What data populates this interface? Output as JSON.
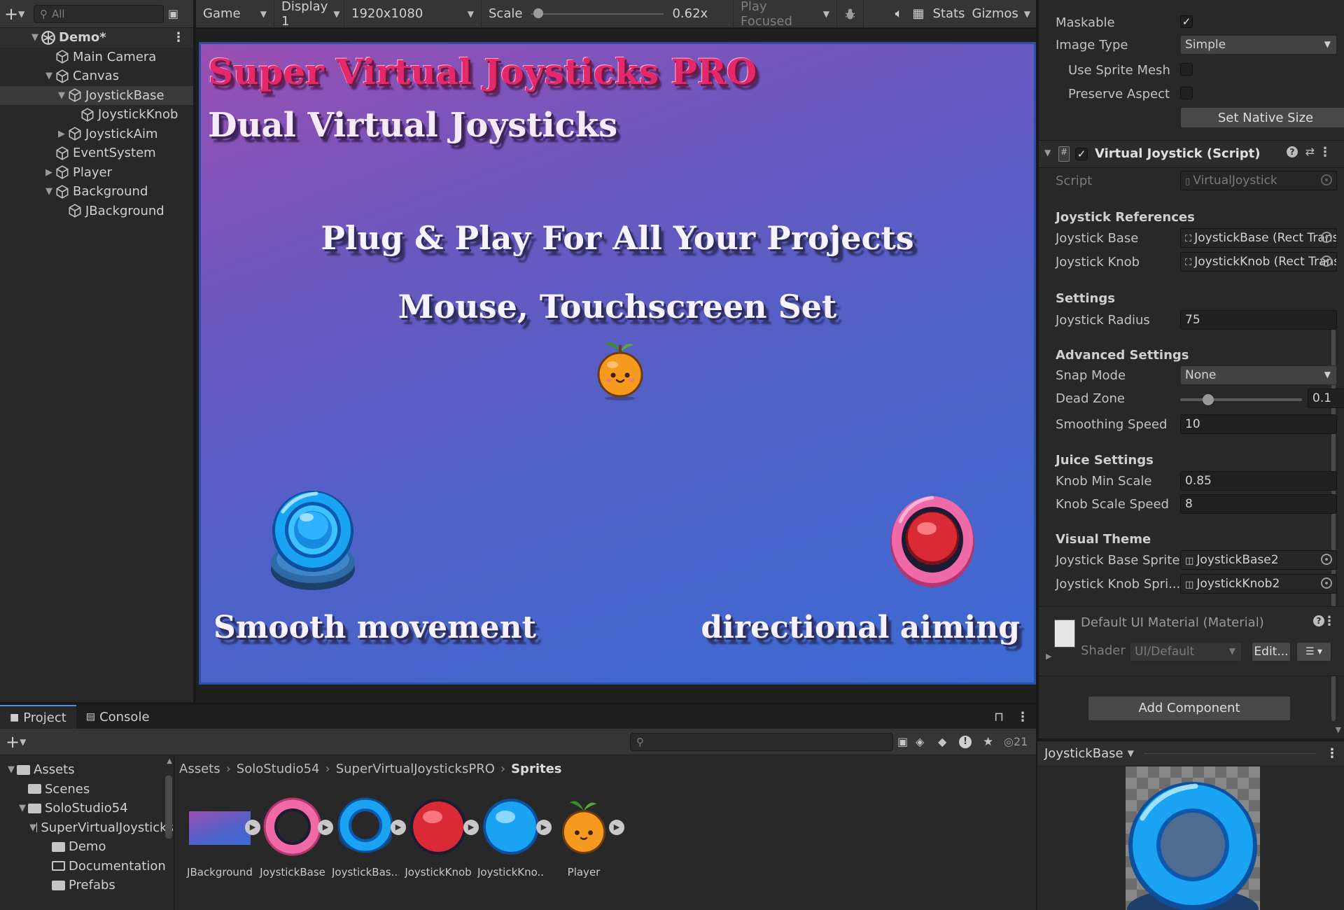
{
  "hierarchy": {
    "search_placeholder": "All",
    "scene_name": "Demo*",
    "items": [
      "Main Camera",
      "Canvas",
      "JoystickBase",
      "JoystickKnob",
      "JoystickAim",
      "EventSystem",
      "Player",
      "Background",
      "JBackground"
    ]
  },
  "game_toolbar": {
    "view": "Game",
    "display": "Display 1",
    "resolution": "1920x1080",
    "scale_label": "Scale",
    "scale_value": "0.62x",
    "scale_fraction": 0.02,
    "play_mode": "Play Focused",
    "stats": "Stats",
    "gizmos": "Gizmos"
  },
  "game_view": {
    "title": "Super Virtual Joysticks PRO",
    "subtitle": "Dual Virtual Joysticks",
    "line1": "Plug & Play For All Your Projects",
    "line2": "Mouse, Touchscreen Set",
    "left_caption": "Smooth movement",
    "right_caption": "directional aiming"
  },
  "inspector": {
    "maskable_label": "Maskable",
    "image_type_label": "Image Type",
    "image_type_value": "Simple",
    "use_sprite_mesh_label": "Use Sprite Mesh",
    "preserve_aspect_label": "Preserve Aspect",
    "set_native_size": "Set Native Size",
    "component_title": "Virtual Joystick (Script)",
    "script_label": "Script",
    "script_value": "VirtualJoystick",
    "sections": {
      "references": "Joystick References",
      "settings": "Settings",
      "advanced": "Advanced Settings",
      "juice": "Juice Settings",
      "visual": "Visual Theme"
    },
    "joystick_base_label": "Joystick Base",
    "joystick_base_value": "JoystickBase (Rect Transform)",
    "joystick_knob_label": "Joystick Knob",
    "joystick_knob_value": "JoystickKnob (Rect Transform)",
    "radius_label": "Joystick Radius",
    "radius_value": "75",
    "snap_label": "Snap Mode",
    "snap_value": "None",
    "deadzone_label": "Dead Zone",
    "deadzone_value": "0.1",
    "smoothing_label": "Smoothing Speed",
    "smoothing_value": "10",
    "knob_min_label": "Knob Min Scale",
    "knob_min_value": "0.85",
    "knob_speed_label": "Knob Scale Speed",
    "knob_speed_value": "8",
    "base_sprite_label": "Joystick Base Sprite",
    "base_sprite_value": "JoystickBase2",
    "knob_sprite_label": "Joystick Knob Spri...",
    "knob_sprite_value": "JoystickKnob2",
    "material_title": "Default UI Material (Material)",
    "shader_label": "Shader",
    "shader_value": "UI/Default",
    "edit_button": "Edit...",
    "add_component": "Add Component"
  },
  "project": {
    "tab_project": "Project",
    "tab_console": "Console",
    "hidden_count": "21",
    "folders": [
      "Assets",
      "Scenes",
      "SoloStudio54",
      "SuperVirtualJoysticks",
      "Demo",
      "Documentation",
      "Prefabs"
    ],
    "breadcrumb": [
      "Assets",
      "SoloStudio54",
      "SuperVirtualJoysticksPRO",
      "Sprites"
    ],
    "assets": [
      "JBackground",
      "JoystickBase",
      "JoystickBas...",
      "JoystickKnob",
      "JoystickKno...",
      "Player"
    ]
  },
  "preview": {
    "title": "JoystickBase"
  },
  "colors": {
    "accent": "#4d90ea",
    "title_pink": "#e5286b",
    "joystick_blue": "#1aa3f2",
    "joystick_pink": "#f06aa8",
    "knob_red": "#d92a36",
    "player_orange": "#f59a1e"
  }
}
